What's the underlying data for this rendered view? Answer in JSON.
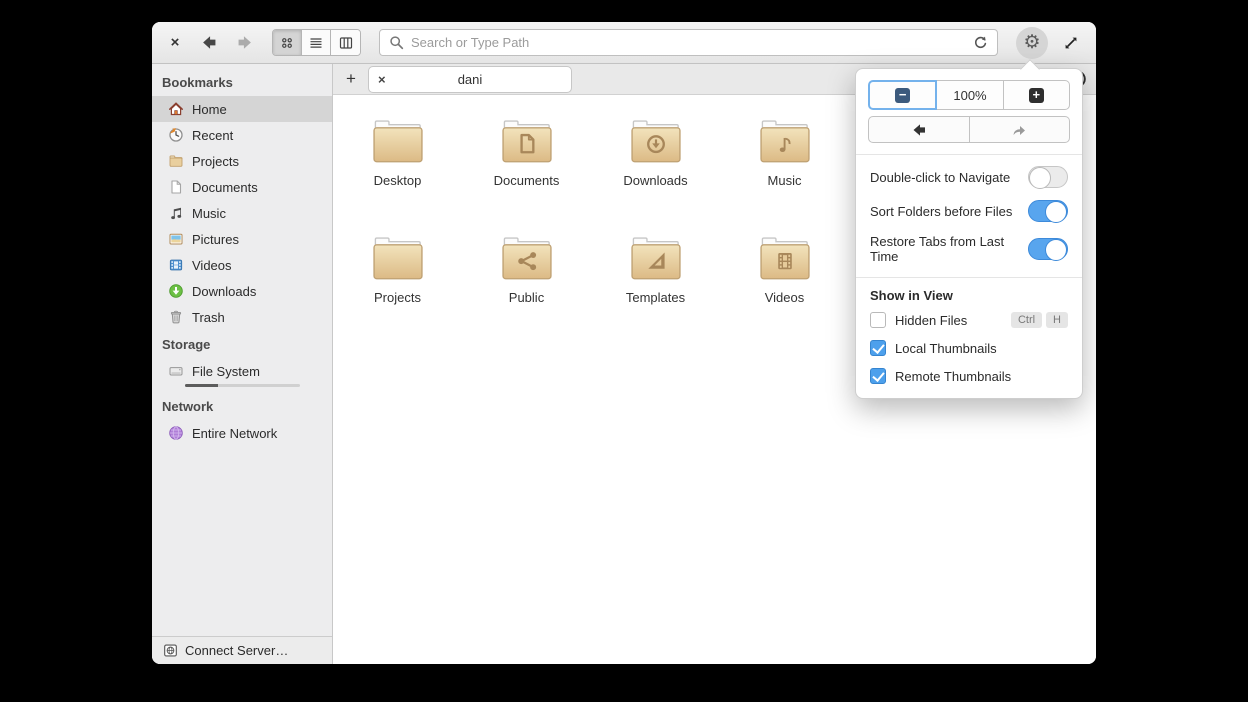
{
  "toolbar": {
    "close_label": "×",
    "search_placeholder": "Search or Type Path"
  },
  "tabbar": {
    "add_label": "+",
    "tab_close_label": "×",
    "tab_label": "dani"
  },
  "sidebar": {
    "sections": [
      {
        "header": "Bookmarks",
        "items": [
          {
            "label": "Home",
            "icon": "home-icon",
            "selected": true
          },
          {
            "label": "Recent",
            "icon": "recent-icon",
            "selected": false
          },
          {
            "label": "Projects",
            "icon": "folder-icon",
            "selected": false
          },
          {
            "label": "Documents",
            "icon": "document-icon",
            "selected": false
          },
          {
            "label": "Music",
            "icon": "music-icon",
            "selected": false
          },
          {
            "label": "Pictures",
            "icon": "pictures-icon",
            "selected": false
          },
          {
            "label": "Videos",
            "icon": "videos-icon",
            "selected": false
          },
          {
            "label": "Downloads",
            "icon": "downloads-icon",
            "selected": false
          },
          {
            "label": "Trash",
            "icon": "trash-icon",
            "selected": false
          }
        ]
      },
      {
        "header": "Storage",
        "items": [
          {
            "label": "File System",
            "icon": "drive-icon",
            "selected": false,
            "usage_percent": 29
          }
        ]
      },
      {
        "header": "Network",
        "items": [
          {
            "label": "Entire Network",
            "icon": "network-icon",
            "selected": false
          }
        ]
      }
    ],
    "connect_server_label": "Connect Server…"
  },
  "files": [
    {
      "label": "Desktop",
      "icon": "folder-plain-icon"
    },
    {
      "label": "Documents",
      "icon": "folder-documents-icon"
    },
    {
      "label": "Downloads",
      "icon": "folder-downloads-icon"
    },
    {
      "label": "Music",
      "icon": "folder-music-icon"
    },
    {
      "label": "Projects",
      "icon": "folder-plain-icon"
    },
    {
      "label": "Public",
      "icon": "folder-public-icon"
    },
    {
      "label": "Templates",
      "icon": "folder-templates-icon"
    },
    {
      "label": "Videos",
      "icon": "folder-videos-icon"
    }
  ],
  "popover": {
    "zoom_out_glyph": "−",
    "zoom_level": "100%",
    "zoom_in_glyph": "+",
    "switches": [
      {
        "label": "Double-click to Navigate",
        "on": false
      },
      {
        "label": "Sort Folders before Files",
        "on": true
      },
      {
        "label": "Restore Tabs from Last Time",
        "on": true
      }
    ],
    "section_header": "Show in View",
    "checkboxes": [
      {
        "label": "Hidden Files",
        "checked": false,
        "shortcut": [
          "Ctrl",
          "H"
        ]
      },
      {
        "label": "Local Thumbnails",
        "checked": true
      },
      {
        "label": "Remote Thumbnails",
        "checked": true
      }
    ]
  },
  "colors": {
    "accent_blue": "#58a5ee",
    "checkbox_blue": "#4da0ec",
    "folder_tan": "#e3c18c",
    "selection_gray": "#d5d5d5"
  }
}
